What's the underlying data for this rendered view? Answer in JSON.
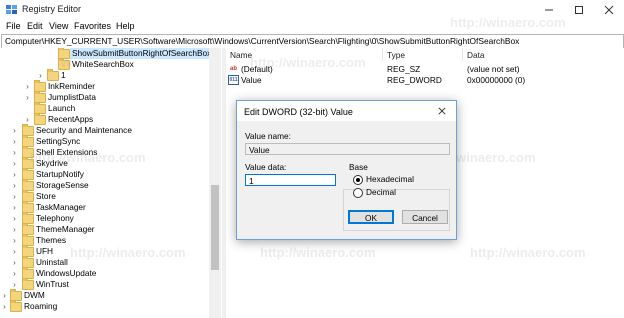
{
  "window": {
    "title": "Registry Editor",
    "controls": [
      "minimize-icon",
      "maximize-icon",
      "close-icon"
    ]
  },
  "menu": [
    "File",
    "Edit",
    "View",
    "Favorites",
    "Help"
  ],
  "address": "Computer\\HKEY_CURRENT_USER\\Software\\Microsoft\\Windows\\CurrentVersion\\Search\\Flighting\\0\\ShowSubmitButtonRightOfSearchBox",
  "tree": {
    "items": [
      {
        "label": "ShowSubmitButtonRightOfSearchBox",
        "selected": true
      },
      {
        "label": "WhiteSearchBox"
      },
      {
        "label": "1"
      },
      {
        "label": "InkReminder"
      },
      {
        "label": "JumplistData"
      },
      {
        "label": "Launch"
      },
      {
        "label": "RecentApps"
      },
      {
        "label": "Security and Maintenance"
      },
      {
        "label": "SettingSync"
      },
      {
        "label": "Shell Extensions"
      },
      {
        "label": "Skydrive"
      },
      {
        "label": "StartupNotify"
      },
      {
        "label": "StorageSense"
      },
      {
        "label": "Store"
      },
      {
        "label": "TaskManager"
      },
      {
        "label": "Telephony"
      },
      {
        "label": "ThemeManager"
      },
      {
        "label": "Themes"
      },
      {
        "label": "UFH"
      },
      {
        "label": "Uninstall"
      },
      {
        "label": "WindowsUpdate"
      },
      {
        "label": "WinTrust"
      },
      {
        "label": "DWM"
      },
      {
        "label": "Roaming"
      }
    ]
  },
  "list": {
    "headers": {
      "name": "Name",
      "type": "Type",
      "data": "Data"
    },
    "rows": [
      {
        "icon": "ab-string-icon",
        "name": "(Default)",
        "type": "REG_SZ",
        "data": "(value not set)"
      },
      {
        "icon": "dword-icon",
        "name": "Value",
        "type": "REG_DWORD",
        "data": "0x00000000 (0)"
      }
    ]
  },
  "dialog": {
    "title": "Edit DWORD (32-bit) Value",
    "value_name_label": "Value name:",
    "value_name": "Value",
    "value_data_label": "Value data:",
    "value_data": "1",
    "base_label": "Base",
    "hex_label": "Hexadecimal",
    "dec_label": "Decimal",
    "base_selected": "Hexadecimal",
    "ok_label": "OK",
    "cancel_label": "Cancel"
  },
  "watermark": "http://winaero.com"
}
